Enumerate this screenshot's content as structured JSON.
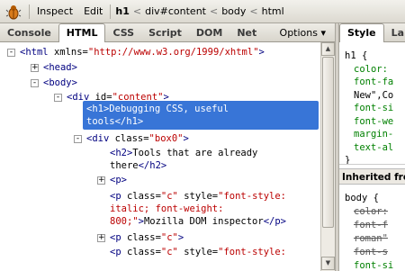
{
  "toolbar": {
    "inspect": "Inspect",
    "edit": "Edit",
    "breadcrumbs": [
      "h1",
      "div#content",
      "body",
      "html"
    ],
    "crumb_sep": "<"
  },
  "tabs": [
    "Console",
    "HTML",
    "CSS",
    "Script",
    "DOM",
    "Net"
  ],
  "active_tab": "HTML",
  "options": "Options ▾",
  "side_tabs": [
    "Style",
    "La"
  ],
  "tree": [
    {
      "tw": "-",
      "parts": [
        [
          "tag",
          "<html "
        ],
        [
          "attr",
          "xmlns="
        ],
        [
          "val",
          "\"http://www.w3.org/1999/xhtml\""
        ],
        [
          "tag",
          ">"
        ]
      ]
    },
    {
      "tw": "+",
      "parts": [
        [
          "tag",
          "<head>"
        ]
      ]
    },
    {
      "tw": "-",
      "parts": [
        [
          "tag",
          "<body>"
        ]
      ]
    },
    {
      "tw": "-",
      "parts": [
        [
          "tag",
          "<div "
        ],
        [
          "attr",
          "id="
        ],
        [
          "val",
          "\"content\""
        ],
        [
          "tag",
          ">"
        ]
      ]
    },
    {
      "tw": "",
      "parts": [
        [
          "tag",
          "<h1>"
        ],
        [
          "txt",
          "Debugging CSS, useful"
        ]
      ]
    },
    {
      "tw": "",
      "parts": [
        [
          "txt",
          "tools"
        ],
        [
          "tag",
          "</h1>"
        ]
      ]
    },
    {
      "tw": "-",
      "parts": [
        [
          "tag",
          "<div "
        ],
        [
          "attr",
          "class="
        ],
        [
          "val",
          "\"box0\""
        ],
        [
          "tag",
          ">"
        ]
      ]
    },
    {
      "tw": "",
      "parts": [
        [
          "tag",
          "<h2>"
        ],
        [
          "txt",
          "Tools that are already"
        ]
      ]
    },
    {
      "tw": "",
      "parts": [
        [
          "txt",
          "there"
        ],
        [
          "tag",
          "</h2>"
        ]
      ]
    },
    {
      "tw": "+",
      "parts": [
        [
          "tag",
          "<p>"
        ]
      ]
    },
    {
      "tw": "",
      "parts": [
        [
          "tag",
          "<p "
        ],
        [
          "attr",
          "class="
        ],
        [
          "val",
          "\"c\""
        ],
        [
          "attr",
          " style="
        ],
        [
          "val",
          "\"font-style:"
        ]
      ]
    },
    {
      "tw": "",
      "parts": [
        [
          "val",
          "italic; font-weight:"
        ]
      ]
    },
    {
      "tw": "",
      "parts": [
        [
          "val",
          "800;\""
        ],
        [
          "tag",
          ">"
        ],
        [
          "txt",
          "Mozilla DOM inspector"
        ],
        [
          "tag",
          "</p>"
        ]
      ]
    },
    {
      "tw": "+",
      "parts": [
        [
          "tag",
          "<p "
        ],
        [
          "attr",
          "class="
        ],
        [
          "val",
          "\"c\""
        ],
        [
          "tag",
          ">"
        ]
      ]
    },
    {
      "tw": "",
      "parts": [
        [
          "tag",
          "<p "
        ],
        [
          "attr",
          "class="
        ],
        [
          "val",
          "\"c\""
        ],
        [
          "attr",
          " style="
        ],
        [
          "val",
          "\"font-style:"
        ]
      ]
    }
  ],
  "style_panel": {
    "rule1": [
      "h1 {",
      "color:",
      "font-fa",
      "New\",Co",
      "font-si",
      "font-we",
      "margin-",
      "text-al",
      "}"
    ],
    "inherited": "Inherited fro",
    "rule2": [
      "body {",
      "color:",
      "font-f",
      "roman\"",
      "font-s",
      "font-si"
    ]
  }
}
